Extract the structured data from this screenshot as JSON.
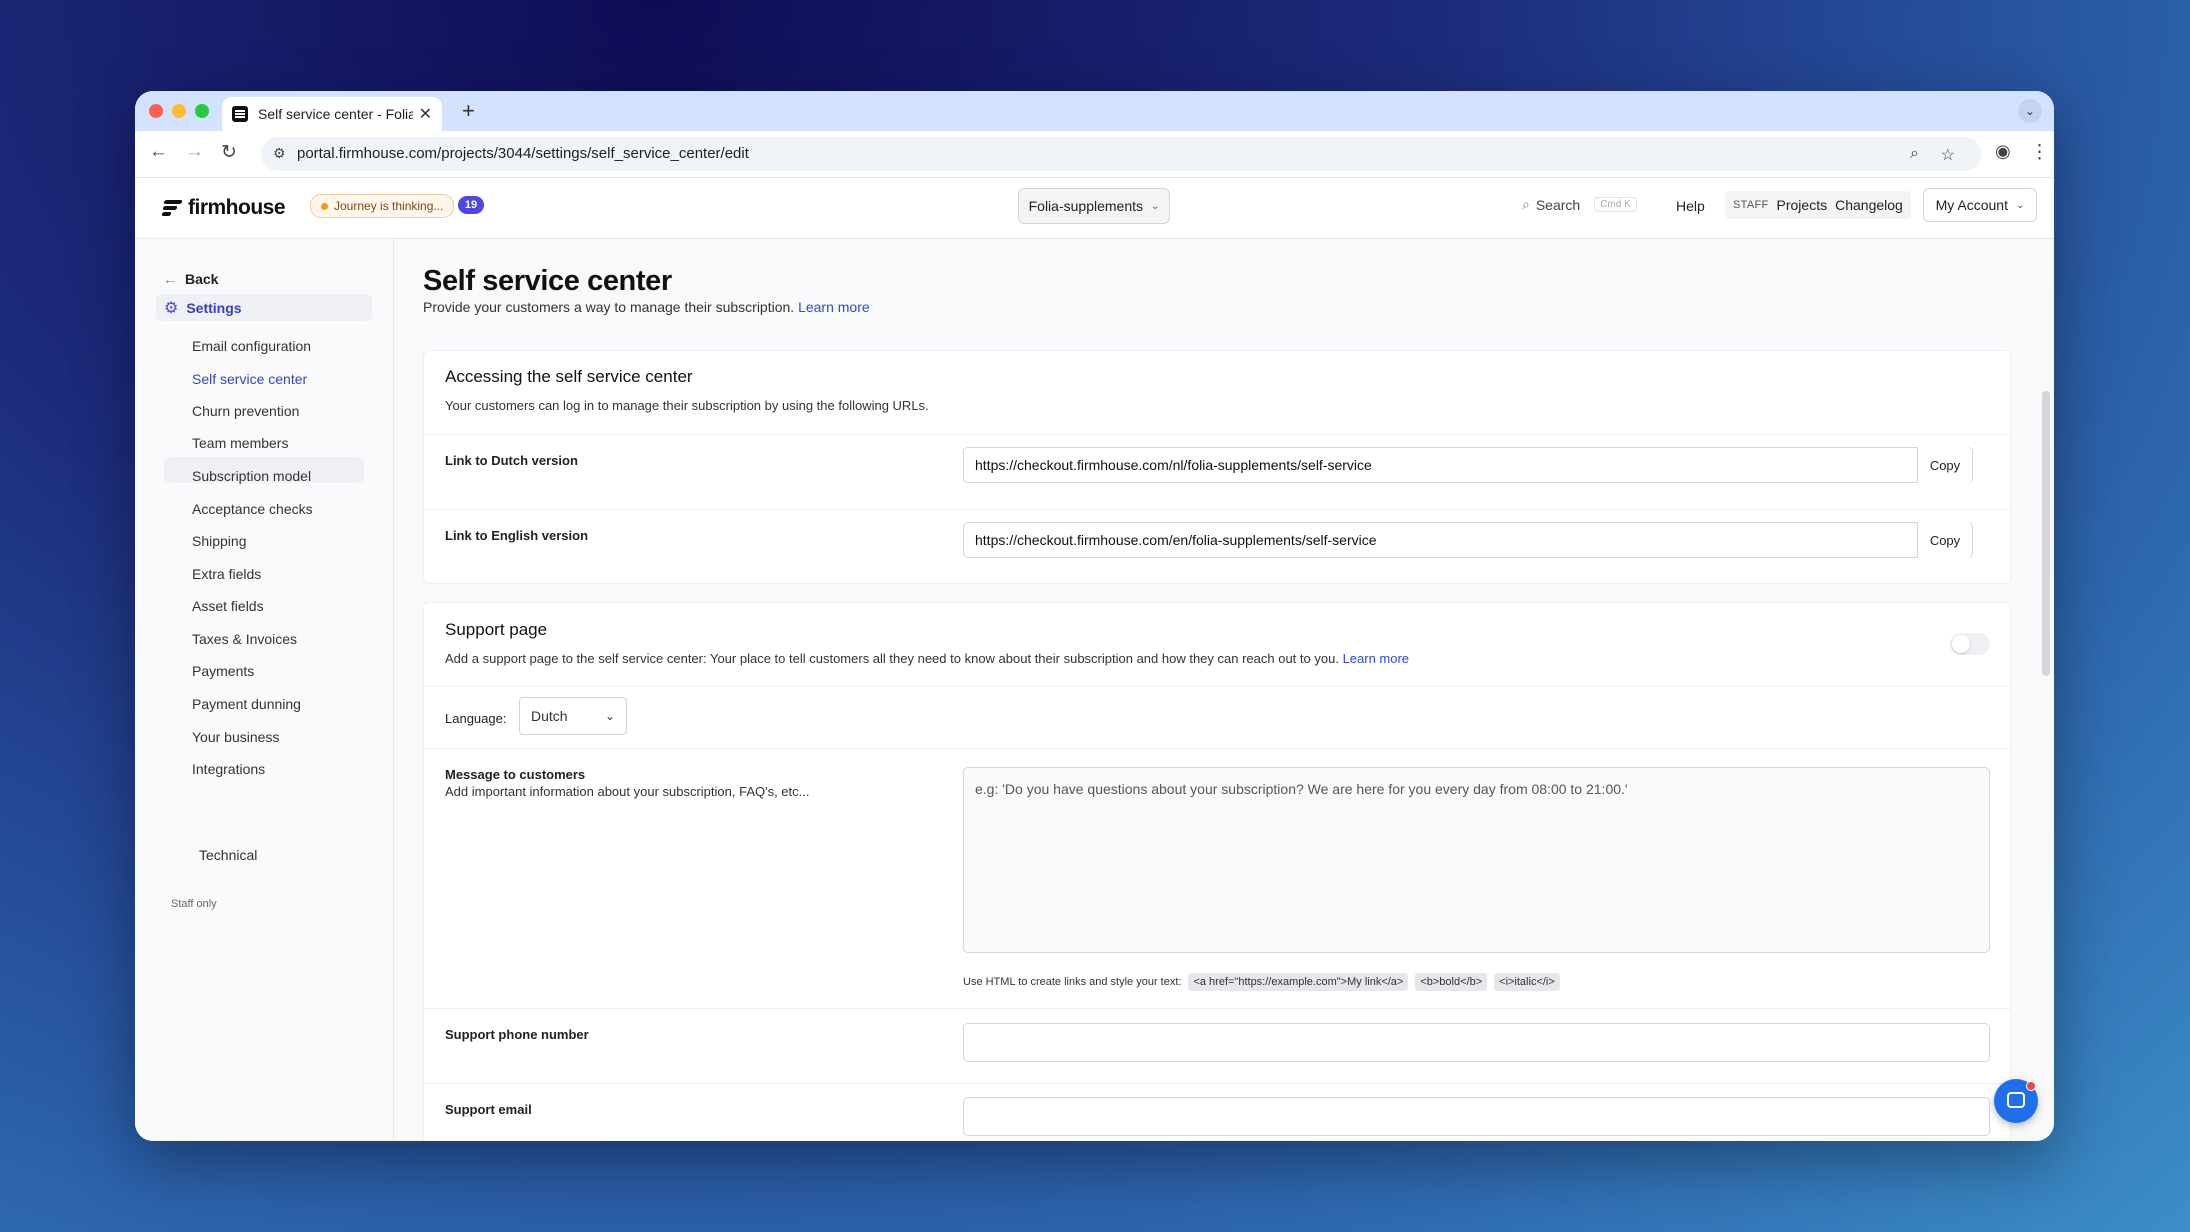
{
  "browser": {
    "tab_title": "Self service center - Folia-sup",
    "url": "portal.firmhouse.com/projects/3044/settings/self_service_center/edit"
  },
  "header": {
    "logo_text": "firmhouse",
    "journey_status": "Journey is thinking...",
    "notification_count": "19",
    "project_name": "Folia-supplements",
    "search_label": "Search",
    "search_shortcut": "Cmd K",
    "help_label": "Help",
    "staff_tag": "STAFF",
    "projects_label": "Projects",
    "changelog_label": "Changelog",
    "account_label": "My Account"
  },
  "sidebar": {
    "back_label": "Back",
    "settings_label": "Settings",
    "items": [
      "Email configuration",
      "Self service center",
      "Churn prevention",
      "Team members",
      "Subscription model",
      "Acceptance checks",
      "Shipping",
      "Extra fields",
      "Asset fields",
      "Taxes & Invoices",
      "Payments",
      "Payment dunning",
      "Your business",
      "Integrations"
    ],
    "staff_only_label": "Staff only",
    "technical_label": "Technical"
  },
  "page": {
    "title": "Self service center",
    "subtitle": "Provide your customers a way to manage their subscription.",
    "learn_more": "Learn more"
  },
  "access_card": {
    "title": "Accessing the self service center",
    "description": "Your customers can log in to manage their subscription by using the following URLs.",
    "dutch_label": "Link to Dutch version",
    "dutch_url": "https://checkout.firmhouse.com/nl/folia-supplements/self-service",
    "english_label": "Link to English version",
    "english_url": "https://checkout.firmhouse.com/en/folia-supplements/self-service",
    "copy_label": "Copy"
  },
  "support_card": {
    "title": "Support page",
    "description": "Add a support page to the self service center: Your place to tell customers all they need to know about their subscription and how they can reach out to you.",
    "learn_more": "Learn more",
    "language_label": "Language:",
    "language_value": "Dutch",
    "message_label": "Message to customers",
    "message_hint": "Add important information about your subscription, FAQ's, etc...",
    "message_placeholder": "e.g: 'Do you have questions about your subscription? We are here for you every day from 08:00 to 21:00.'",
    "html_hint": "Use HTML to create links and style your text:",
    "html_examples": [
      "<a href=\"https://example.com\">My link</a>",
      "<b>bold</b>",
      "<i>italic</i>"
    ],
    "phone_label": "Support phone number",
    "email_label": "Support email"
  }
}
